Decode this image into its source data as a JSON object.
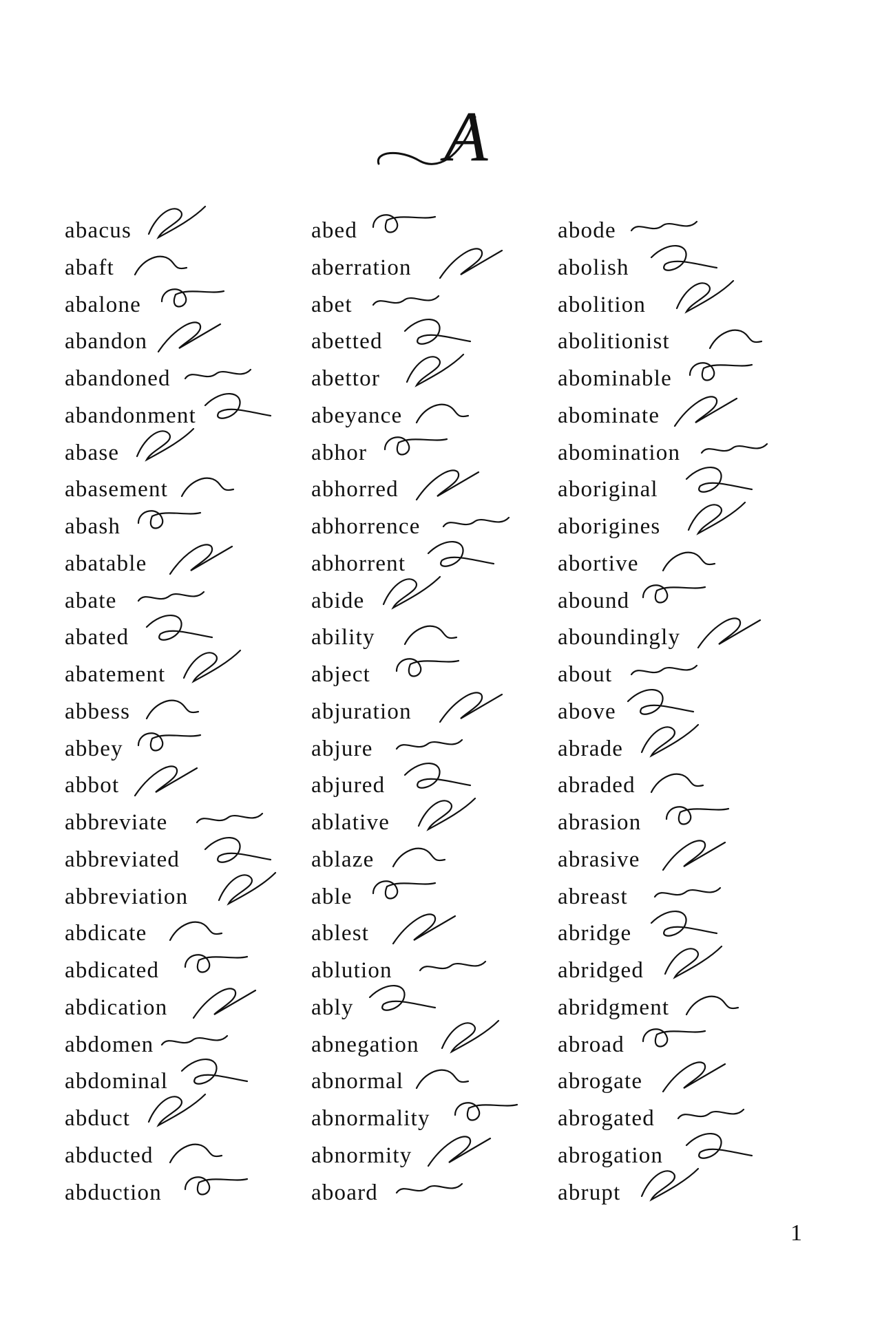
{
  "section_letter": "A",
  "page_number": "1",
  "columns": [
    {
      "entries": [
        {
          "word": "abacus",
          "outline_icon": "shorthand-outline-icon"
        },
        {
          "word": "abaft",
          "outline_icon": "shorthand-outline-icon"
        },
        {
          "word": "abalone",
          "outline_icon": "shorthand-outline-icon"
        },
        {
          "word": "abandon",
          "outline_icon": "shorthand-outline-icon"
        },
        {
          "word": "abandoned",
          "outline_icon": "shorthand-outline-icon"
        },
        {
          "word": "abandonment",
          "outline_icon": "shorthand-outline-icon"
        },
        {
          "word": "abase",
          "outline_icon": "shorthand-outline-icon"
        },
        {
          "word": "abasement",
          "outline_icon": "shorthand-outline-icon"
        },
        {
          "word": "abash",
          "outline_icon": "shorthand-outline-icon"
        },
        {
          "word": "abatable",
          "outline_icon": "shorthand-outline-icon"
        },
        {
          "word": "abate",
          "outline_icon": "shorthand-outline-icon"
        },
        {
          "word": "abated",
          "outline_icon": "shorthand-outline-icon"
        },
        {
          "word": "abatement",
          "outline_icon": "shorthand-outline-icon"
        },
        {
          "word": "abbess",
          "outline_icon": "shorthand-outline-icon"
        },
        {
          "word": "abbey",
          "outline_icon": "shorthand-outline-icon"
        },
        {
          "word": "abbot",
          "outline_icon": "shorthand-outline-icon"
        },
        {
          "word": "abbreviate",
          "outline_icon": "shorthand-outline-icon"
        },
        {
          "word": "abbreviated",
          "outline_icon": "shorthand-outline-icon"
        },
        {
          "word": "abbreviation",
          "outline_icon": "shorthand-outline-icon"
        },
        {
          "word": "abdicate",
          "outline_icon": "shorthand-outline-icon"
        },
        {
          "word": "abdicated",
          "outline_icon": "shorthand-outline-icon"
        },
        {
          "word": "abdication",
          "outline_icon": "shorthand-outline-icon"
        },
        {
          "word": "abdomen",
          "outline_icon": "shorthand-outline-icon"
        },
        {
          "word": "abdominal",
          "outline_icon": "shorthand-outline-icon"
        },
        {
          "word": "abduct",
          "outline_icon": "shorthand-outline-icon"
        },
        {
          "word": "abducted",
          "outline_icon": "shorthand-outline-icon"
        },
        {
          "word": "abduction",
          "outline_icon": "shorthand-outline-icon"
        }
      ]
    },
    {
      "entries": [
        {
          "word": "abed",
          "outline_icon": "shorthand-outline-icon"
        },
        {
          "word": "aberration",
          "outline_icon": "shorthand-outline-icon"
        },
        {
          "word": "abet",
          "outline_icon": "shorthand-outline-icon"
        },
        {
          "word": "abetted",
          "outline_icon": "shorthand-outline-icon"
        },
        {
          "word": "abettor",
          "outline_icon": "shorthand-outline-icon"
        },
        {
          "word": "abeyance",
          "outline_icon": "shorthand-outline-icon"
        },
        {
          "word": "abhor",
          "outline_icon": "shorthand-outline-icon"
        },
        {
          "word": "abhorred",
          "outline_icon": "shorthand-outline-icon"
        },
        {
          "word": "abhorrence",
          "outline_icon": "shorthand-outline-icon"
        },
        {
          "word": "abhorrent",
          "outline_icon": "shorthand-outline-icon"
        },
        {
          "word": "abide",
          "outline_icon": "shorthand-outline-icon"
        },
        {
          "word": "ability",
          "outline_icon": "shorthand-outline-icon"
        },
        {
          "word": "abject",
          "outline_icon": "shorthand-outline-icon"
        },
        {
          "word": "abjuration",
          "outline_icon": "shorthand-outline-icon"
        },
        {
          "word": "abjure",
          "outline_icon": "shorthand-outline-icon"
        },
        {
          "word": "abjured",
          "outline_icon": "shorthand-outline-icon"
        },
        {
          "word": "ablative",
          "outline_icon": "shorthand-outline-icon"
        },
        {
          "word": "ablaze",
          "outline_icon": "shorthand-outline-icon"
        },
        {
          "word": "able",
          "outline_icon": "shorthand-outline-icon"
        },
        {
          "word": "ablest",
          "outline_icon": "shorthand-outline-icon"
        },
        {
          "word": "ablution",
          "outline_icon": "shorthand-outline-icon"
        },
        {
          "word": "ably",
          "outline_icon": "shorthand-outline-icon"
        },
        {
          "word": "abnegation",
          "outline_icon": "shorthand-outline-icon"
        },
        {
          "word": "abnormal",
          "outline_icon": "shorthand-outline-icon"
        },
        {
          "word": "abnormality",
          "outline_icon": "shorthand-outline-icon"
        },
        {
          "word": "abnormity",
          "outline_icon": "shorthand-outline-icon"
        },
        {
          "word": "aboard",
          "outline_icon": "shorthand-outline-icon"
        }
      ]
    },
    {
      "entries": [
        {
          "word": "abode",
          "outline_icon": "shorthand-outline-icon"
        },
        {
          "word": "abolish",
          "outline_icon": "shorthand-outline-icon"
        },
        {
          "word": "abolition",
          "outline_icon": "shorthand-outline-icon"
        },
        {
          "word": "abolitionist",
          "outline_icon": "shorthand-outline-icon"
        },
        {
          "word": "abominable",
          "outline_icon": "shorthand-outline-icon"
        },
        {
          "word": "abominate",
          "outline_icon": "shorthand-outline-icon"
        },
        {
          "word": "abomination",
          "outline_icon": "shorthand-outline-icon"
        },
        {
          "word": "aboriginal",
          "outline_icon": "shorthand-outline-icon"
        },
        {
          "word": "aborigines",
          "outline_icon": "shorthand-outline-icon"
        },
        {
          "word": "abortive",
          "outline_icon": "shorthand-outline-icon"
        },
        {
          "word": "abound",
          "outline_icon": "shorthand-outline-icon"
        },
        {
          "word": "aboundingly",
          "outline_icon": "shorthand-outline-icon"
        },
        {
          "word": "about",
          "outline_icon": "shorthand-outline-icon"
        },
        {
          "word": "above",
          "outline_icon": "shorthand-outline-icon"
        },
        {
          "word": "abrade",
          "outline_icon": "shorthand-outline-icon"
        },
        {
          "word": "abraded",
          "outline_icon": "shorthand-outline-icon"
        },
        {
          "word": "abrasion",
          "outline_icon": "shorthand-outline-icon"
        },
        {
          "word": "abrasive",
          "outline_icon": "shorthand-outline-icon"
        },
        {
          "word": "abreast",
          "outline_icon": "shorthand-outline-icon"
        },
        {
          "word": "abridge",
          "outline_icon": "shorthand-outline-icon"
        },
        {
          "word": "abridged",
          "outline_icon": "shorthand-outline-icon"
        },
        {
          "word": "abridgment",
          "outline_icon": "shorthand-outline-icon"
        },
        {
          "word": "abroad",
          "outline_icon": "shorthand-outline-icon"
        },
        {
          "word": "abrogate",
          "outline_icon": "shorthand-outline-icon"
        },
        {
          "word": "abrogated",
          "outline_icon": "shorthand-outline-icon"
        },
        {
          "word": "abrogation",
          "outline_icon": "shorthand-outline-icon"
        },
        {
          "word": "abrupt",
          "outline_icon": "shorthand-outline-icon"
        }
      ]
    }
  ]
}
